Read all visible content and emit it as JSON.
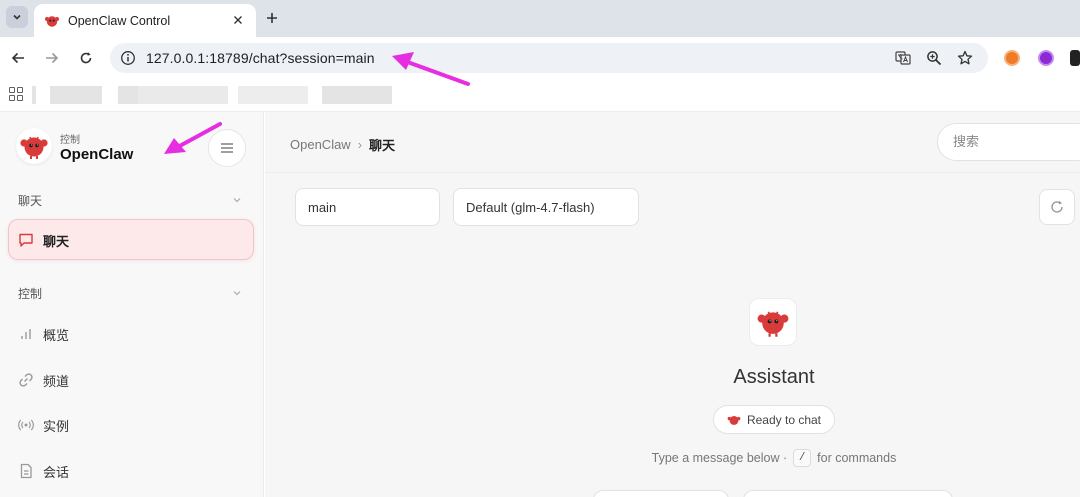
{
  "browser": {
    "tab_title": "OpenClaw Control",
    "url": "127.0.0.1:18789/chat?session=main"
  },
  "sidebar": {
    "brand_sub": "控制",
    "brand_name": "OpenClaw",
    "groups": [
      {
        "label": "聊天"
      },
      {
        "label": "控制"
      }
    ],
    "items": [
      {
        "label": "聊天",
        "icon": "chat-bubble-icon",
        "active": true
      },
      {
        "label": "概览",
        "icon": "bar-chart-icon"
      },
      {
        "label": "频道",
        "icon": "link-icon"
      },
      {
        "label": "实例",
        "icon": "broadcast-icon"
      },
      {
        "label": "会话",
        "icon": "document-icon"
      }
    ]
  },
  "main": {
    "breadcrumb": {
      "root": "OpenClaw",
      "separator": "›",
      "current": "聊天"
    },
    "search_placeholder": "搜索",
    "session_select": "main",
    "model_select": "Default (glm-4.7-flash)",
    "assistant_name": "Assistant",
    "ready_label": "Ready to chat",
    "hint_before": "Type a message below ·",
    "hint_key": "/",
    "hint_after": "for commands"
  },
  "colors": {
    "accent": "#d93a3a",
    "active_bg": "#fde9e9",
    "annotation_arrow": "#e62ee0"
  }
}
